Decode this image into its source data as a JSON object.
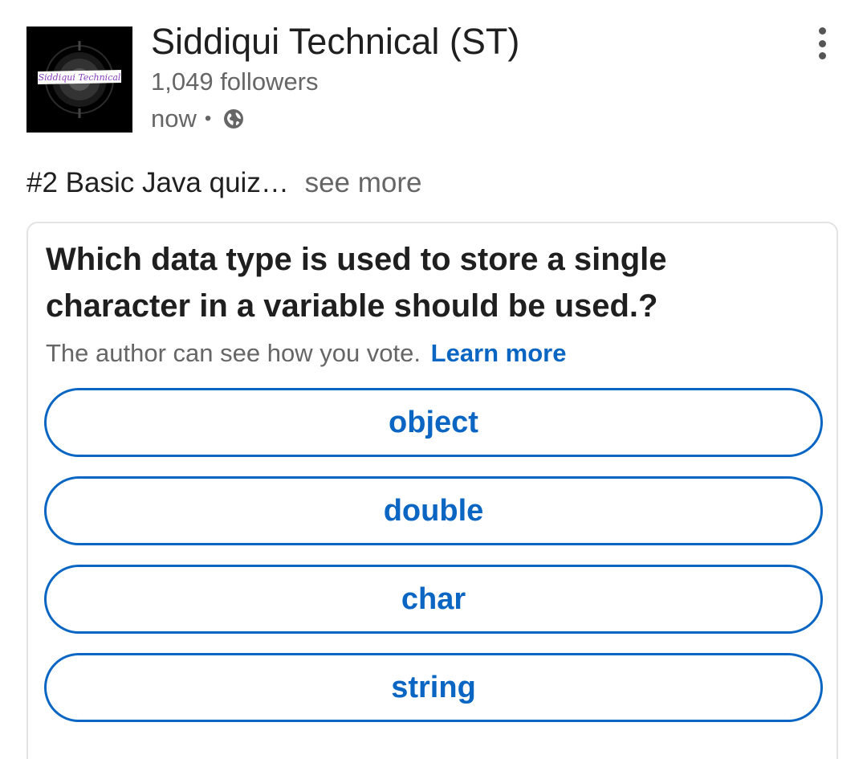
{
  "author": {
    "name": "Siddiqui Technical (ST)",
    "followers": "1,049 followers",
    "time": "now",
    "separator": "•",
    "logo_text": "Siddiqui Technical"
  },
  "post": {
    "text": "#2 Basic Java quiz…",
    "see_more": "see more"
  },
  "poll": {
    "question": "Which data type is used to store a single character in a variable should be used.?",
    "note": "The author can see how you vote.",
    "learn_more": "Learn more",
    "options": [
      "object",
      "double",
      "char",
      "string"
    ]
  },
  "colors": {
    "accent": "#0a66c2",
    "text": "#1f1f1f",
    "muted": "#666666"
  },
  "icons": {
    "more": "more-vertical-icon",
    "visibility": "globe-icon"
  }
}
